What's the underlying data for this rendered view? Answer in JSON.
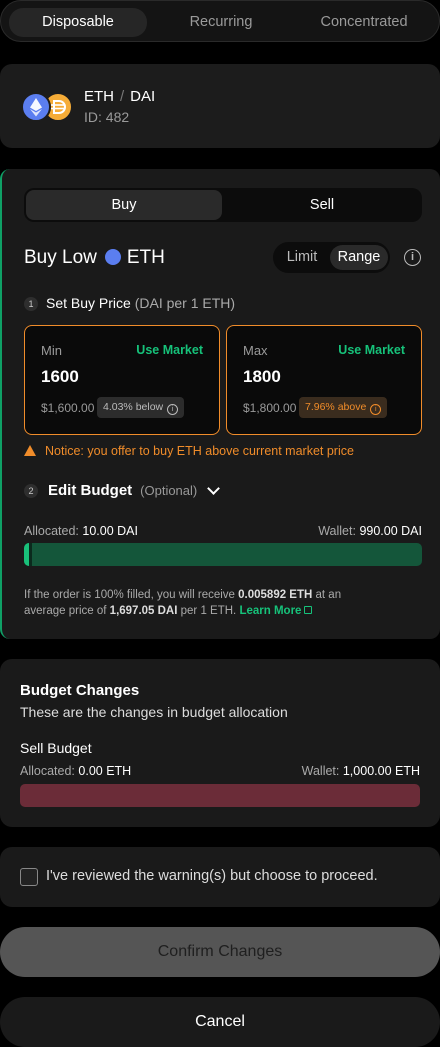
{
  "strategy_tabs": [
    {
      "label": "Disposable",
      "active": true
    },
    {
      "label": "Recurring",
      "active": false
    },
    {
      "label": "Concentrated",
      "active": false
    }
  ],
  "pair": {
    "base": "ETH",
    "quote": "DAI",
    "separator": "/",
    "id_text": "ID: 482"
  },
  "order": {
    "buy_label": "Buy",
    "sell_label": "Sell",
    "title_prefix": "Buy Low",
    "title_token": "ETH",
    "limit_label": "Limit",
    "range_label": "Range",
    "step1_num": "1",
    "step1_title": "Set Buy Price",
    "step1_sub": "(DAI per 1 ETH)",
    "min": {
      "label": "Min",
      "market_label": "Use Market",
      "value": "1600",
      "usd": "$1,600.00",
      "badge": "4.03% below"
    },
    "max": {
      "label": "Max",
      "market_label": "Use Market",
      "value": "1800",
      "usd": "$1,800.00",
      "badge": "7.96% above"
    },
    "notice": "Notice: you offer to buy ETH above current market price",
    "step2_num": "2",
    "step2_title": "Edit Budget",
    "step2_optional": "(Optional)",
    "allocated_label": "Allocated:",
    "allocated_value": "10.00 DAI",
    "wallet_label": "Wallet:",
    "wallet_value": "990.00 DAI",
    "budget_fraction": 0.0101,
    "fill_text_1": "If the order is 100% filled, you will receive",
    "fill_amount": "0.005892 ETH",
    "fill_text_2": "at an average price of",
    "fill_price": "1,697.05 DAI",
    "fill_text_3": "per 1 ETH.",
    "learn_more": "Learn More"
  },
  "budget_changes": {
    "title": "Budget Changes",
    "subtitle": "These are the changes in budget allocation",
    "sell_title": "Sell Budget",
    "allocated_label": "Allocated:",
    "allocated_value": "0.00 ETH",
    "wallet_label": "Wallet:",
    "wallet_value": "1,000.00 ETH"
  },
  "confirm_warning": {
    "label": "I've reviewed the warning(s) but choose to proceed.",
    "checked": false
  },
  "buttons": {
    "confirm": "Confirm Changes",
    "cancel": "Cancel"
  },
  "colors": {
    "accent_green": "#16c27a",
    "warning_orange": "#f08c2a",
    "sell_red": "#6b2c38",
    "eth_blue": "#5b7ef0",
    "dai_orange": "#f5ac37"
  }
}
